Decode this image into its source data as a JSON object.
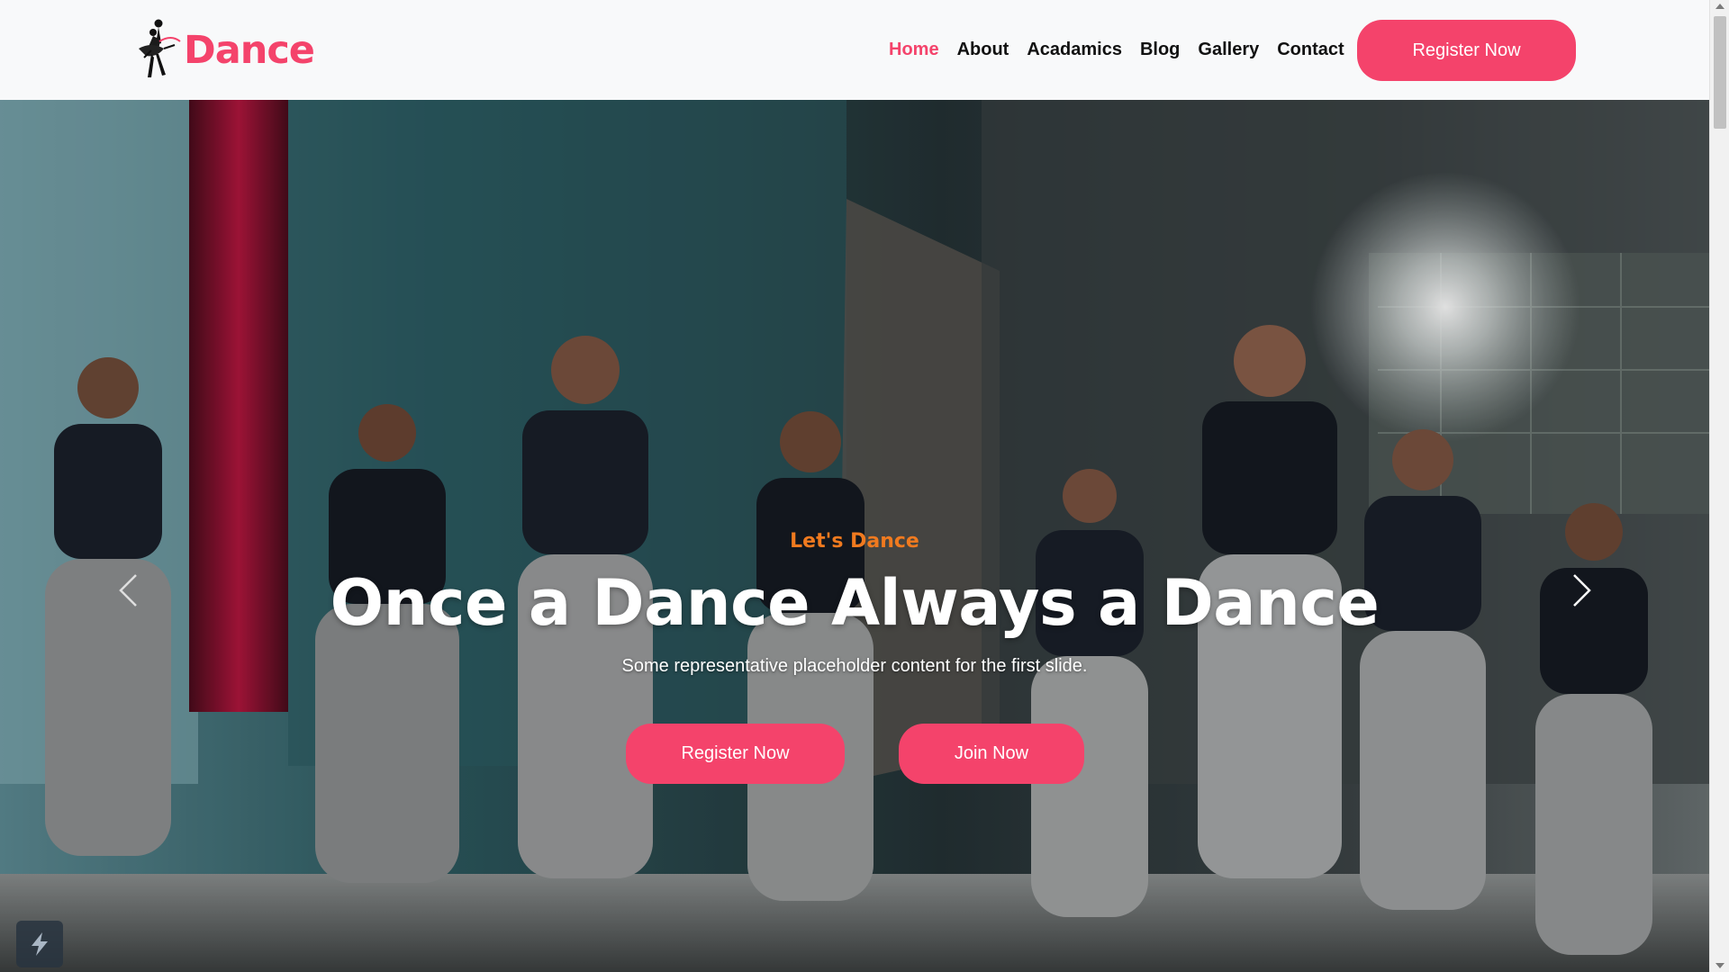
{
  "brand": {
    "name": "Dance",
    "accent": "#f4436b"
  },
  "nav": {
    "items": [
      {
        "label": "Home",
        "active": true
      },
      {
        "label": "About",
        "active": false
      },
      {
        "label": "Acadamics",
        "active": false
      },
      {
        "label": "Blog",
        "active": false
      },
      {
        "label": "Gallery",
        "active": false
      },
      {
        "label": "Contact",
        "active": false
      }
    ],
    "register_label": "Register Now"
  },
  "hero": {
    "eyebrow": "Let's Dance",
    "eyebrow_color": "#f07a1f",
    "title": "Once a Dance Always a Dance",
    "subtitle": "Some representative placeholder content for the first slide.",
    "primary_button": "Register Now",
    "secondary_button": "Join Now",
    "prev_icon": "chevron-left-icon",
    "next_icon": "chevron-right-icon"
  }
}
